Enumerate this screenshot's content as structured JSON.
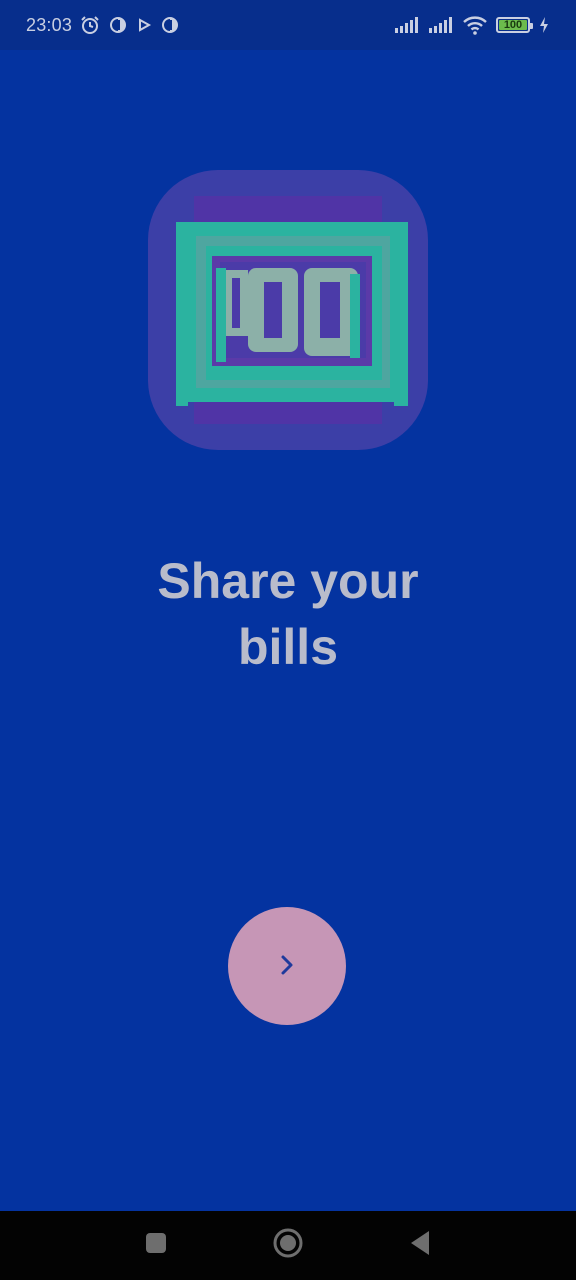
{
  "status_bar": {
    "time": "23:03",
    "battery_level": "100",
    "left_icons": [
      "alarm-icon",
      "app-notification-icon",
      "play-icon",
      "app-notification-icon"
    ],
    "right_icons": [
      "signal-icon",
      "signal-icon",
      "wifi-icon",
      "battery-icon",
      "charging-icon"
    ]
  },
  "onboarding": {
    "logo_icon": "bill-100-icon",
    "title": "Share your\nbills",
    "next_icon": "chevron-right-icon"
  },
  "nav_bar": {
    "items": [
      "recents-icon",
      "home-icon",
      "back-icon"
    ]
  },
  "colors": {
    "background": "#0433a0",
    "status_bar": "#072e8c",
    "title_text": "#b9bccb",
    "logo_tile": "#3c3fa7",
    "logo_teal": "#2bb3a0",
    "button": "#c696b6",
    "chevron": "#1f3a9c",
    "nav_bar": "#030303"
  }
}
